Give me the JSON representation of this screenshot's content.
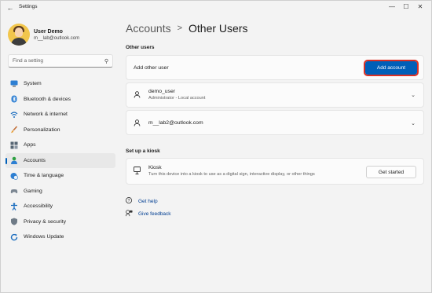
{
  "window": {
    "title": "Settings",
    "back_icon": "back-arrow-icon",
    "controls": {
      "minimize": "—",
      "maximize": "☐",
      "close": "✕"
    }
  },
  "profile": {
    "name": "User Demo",
    "email": "m__lab@outlook.com"
  },
  "search": {
    "placeholder": "Find a setting"
  },
  "sidebar": {
    "items": [
      {
        "label": "System",
        "icon": "monitor-icon",
        "selected": false
      },
      {
        "label": "Bluetooth & devices",
        "icon": "bluetooth-icon",
        "selected": false
      },
      {
        "label": "Network & internet",
        "icon": "wifi-icon",
        "selected": false
      },
      {
        "label": "Personalization",
        "icon": "brush-icon",
        "selected": false
      },
      {
        "label": "Apps",
        "icon": "apps-icon",
        "selected": false
      },
      {
        "label": "Accounts",
        "icon": "person-icon",
        "selected": true
      },
      {
        "label": "Time & language",
        "icon": "clock-globe-icon",
        "selected": false
      },
      {
        "label": "Gaming",
        "icon": "gamepad-icon",
        "selected": false
      },
      {
        "label": "Accessibility",
        "icon": "accessibility-icon",
        "selected": false
      },
      {
        "label": "Privacy & security",
        "icon": "shield-icon",
        "selected": false
      },
      {
        "label": "Windows Update",
        "icon": "update-icon",
        "selected": false
      }
    ]
  },
  "breadcrumb": {
    "parent": "Accounts",
    "separator": ">",
    "current": "Other Users"
  },
  "other_users": {
    "section_label": "Other users",
    "add_row_label": "Add other user",
    "add_button_label": "Add account",
    "users": [
      {
        "name": "demo_user",
        "subtitle": "Administrator - Local account"
      },
      {
        "name": "m__lab2@outlook.com",
        "subtitle": ""
      }
    ]
  },
  "kiosk": {
    "section_label": "Set up a kiosk",
    "title": "Kiosk",
    "description": "Turn this device into a kiosk to use as a digital sign, interactive display, or other things",
    "button_label": "Get started"
  },
  "links": [
    {
      "label": "Get help",
      "icon": "help-icon"
    },
    {
      "label": "Give feedback",
      "icon": "feedback-icon"
    }
  ],
  "colors": {
    "accent": "#005fb8",
    "highlight_outline": "#d93025",
    "background": "#f3f3f3",
    "card": "#fbfbfb"
  }
}
